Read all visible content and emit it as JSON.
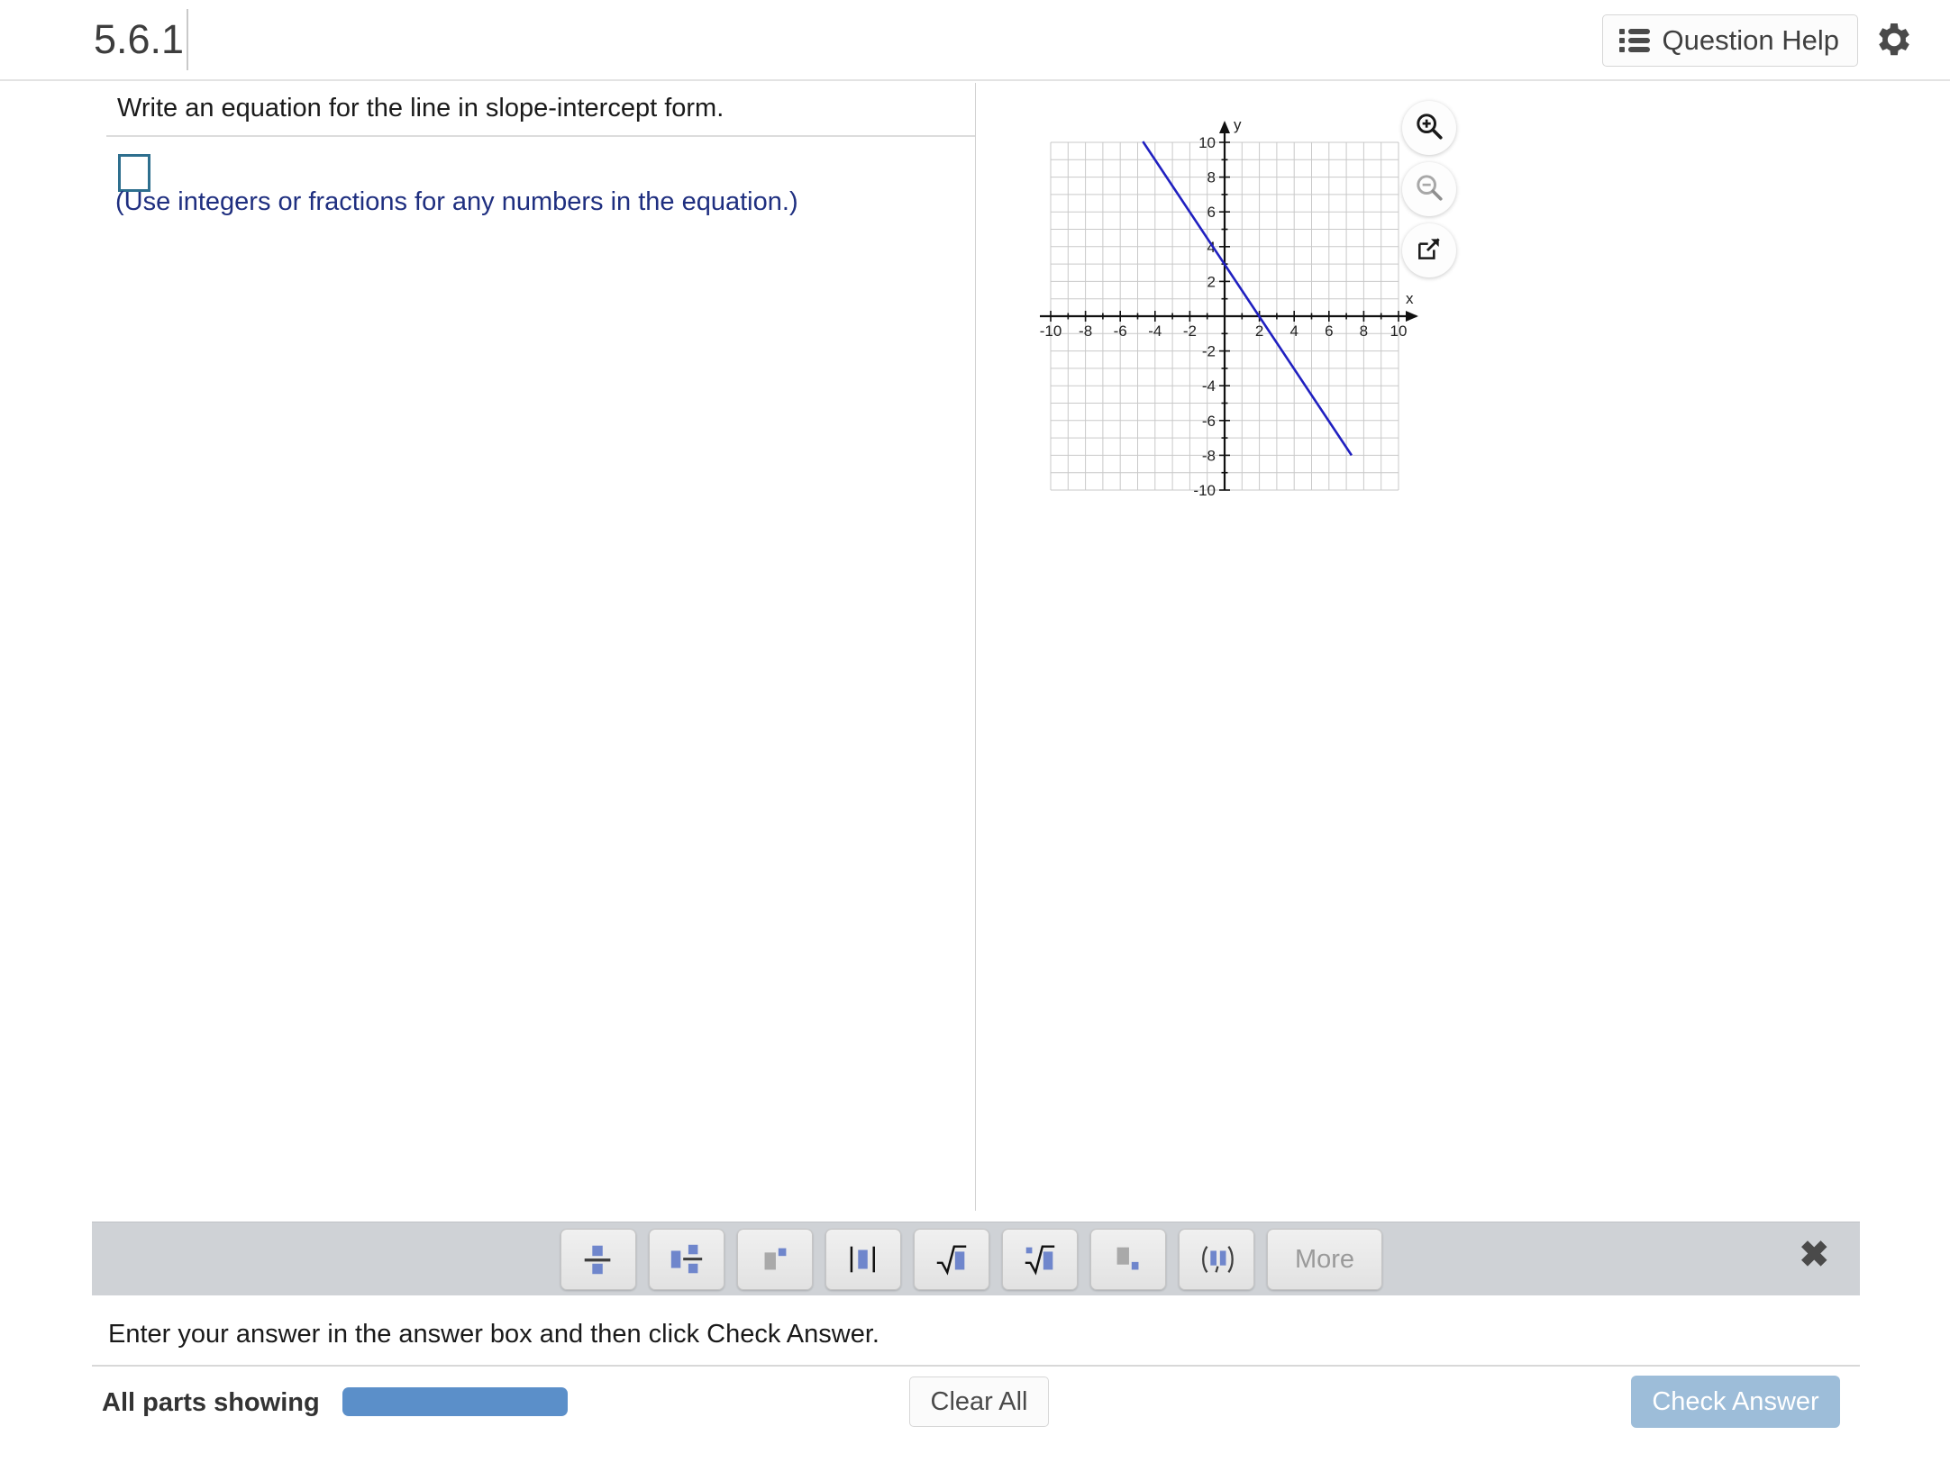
{
  "header": {
    "question_number": "5.6.1",
    "question_help_label": "Question Help",
    "list_icon": "list-icon",
    "gear_icon": "gear-icon"
  },
  "question": {
    "prompt": "Write an equation for the line in slope-intercept form.",
    "answer_value": "",
    "answer_placeholder": "",
    "hint": "(Use integers or fractions for any numbers in the equation.)"
  },
  "graph_controls": {
    "zoom_in_icon": "magnifier-plus-icon",
    "zoom_out_icon": "magnifier-minus-icon",
    "popout_icon": "open-in-new-window-icon"
  },
  "toolbar": {
    "buttons": [
      {
        "name": "fraction-template-button",
        "icon": "fraction-icon"
      },
      {
        "name": "mixed-number-template-button",
        "icon": "mixed-number-icon"
      },
      {
        "name": "exponent-template-button",
        "icon": "exponent-icon"
      },
      {
        "name": "absolute-value-template-button",
        "icon": "absolute-value-icon"
      },
      {
        "name": "square-root-template-button",
        "icon": "square-root-icon"
      },
      {
        "name": "nth-root-template-button",
        "icon": "nth-root-icon"
      },
      {
        "name": "subscript-template-button",
        "icon": "subscript-icon"
      },
      {
        "name": "ordered-pair-template-button",
        "icon": "ordered-pair-icon"
      }
    ],
    "more_label": "More",
    "close_icon": "close-icon"
  },
  "footer": {
    "instruction": "Enter your answer in the answer box and then click Check Answer.",
    "parts_label": "All parts showing",
    "clear_all_label": "Clear All",
    "check_answer_label": "Check Answer",
    "progress_bar_color": "#5b8fc9",
    "check_button_color": "#9dbdd9"
  },
  "chart_data": {
    "type": "line",
    "title": "",
    "xlabel": "x",
    "ylabel": "y",
    "xlim": [
      -10,
      10
    ],
    "ylim": [
      -10,
      10
    ],
    "xticks": [
      -10,
      -8,
      -6,
      -4,
      -2,
      2,
      4,
      6,
      8,
      10
    ],
    "yticks": [
      10,
      8,
      6,
      4,
      2,
      -2,
      -4,
      -6,
      -8,
      -10
    ],
    "xtick_labels": [
      "-10",
      "-8",
      "-6",
      "-4",
      "-2",
      "2",
      "4",
      "6",
      "8",
      "10"
    ],
    "ytick_labels": [
      "10",
      "8",
      "6",
      "4",
      "2",
      "-2",
      "-4",
      "-6",
      "-8",
      "-10"
    ],
    "grid": true,
    "grid_spacing": 1,
    "legend": "none",
    "series": [
      {
        "name": "line",
        "color": "#2020c0",
        "slope": -1.5,
        "intercept": 3,
        "points": [
          [
            -4.7,
            10.05
          ],
          [
            7.3,
            -8.0
          ]
        ],
        "x_intercept": 2,
        "y_intercept": 3
      }
    ]
  }
}
